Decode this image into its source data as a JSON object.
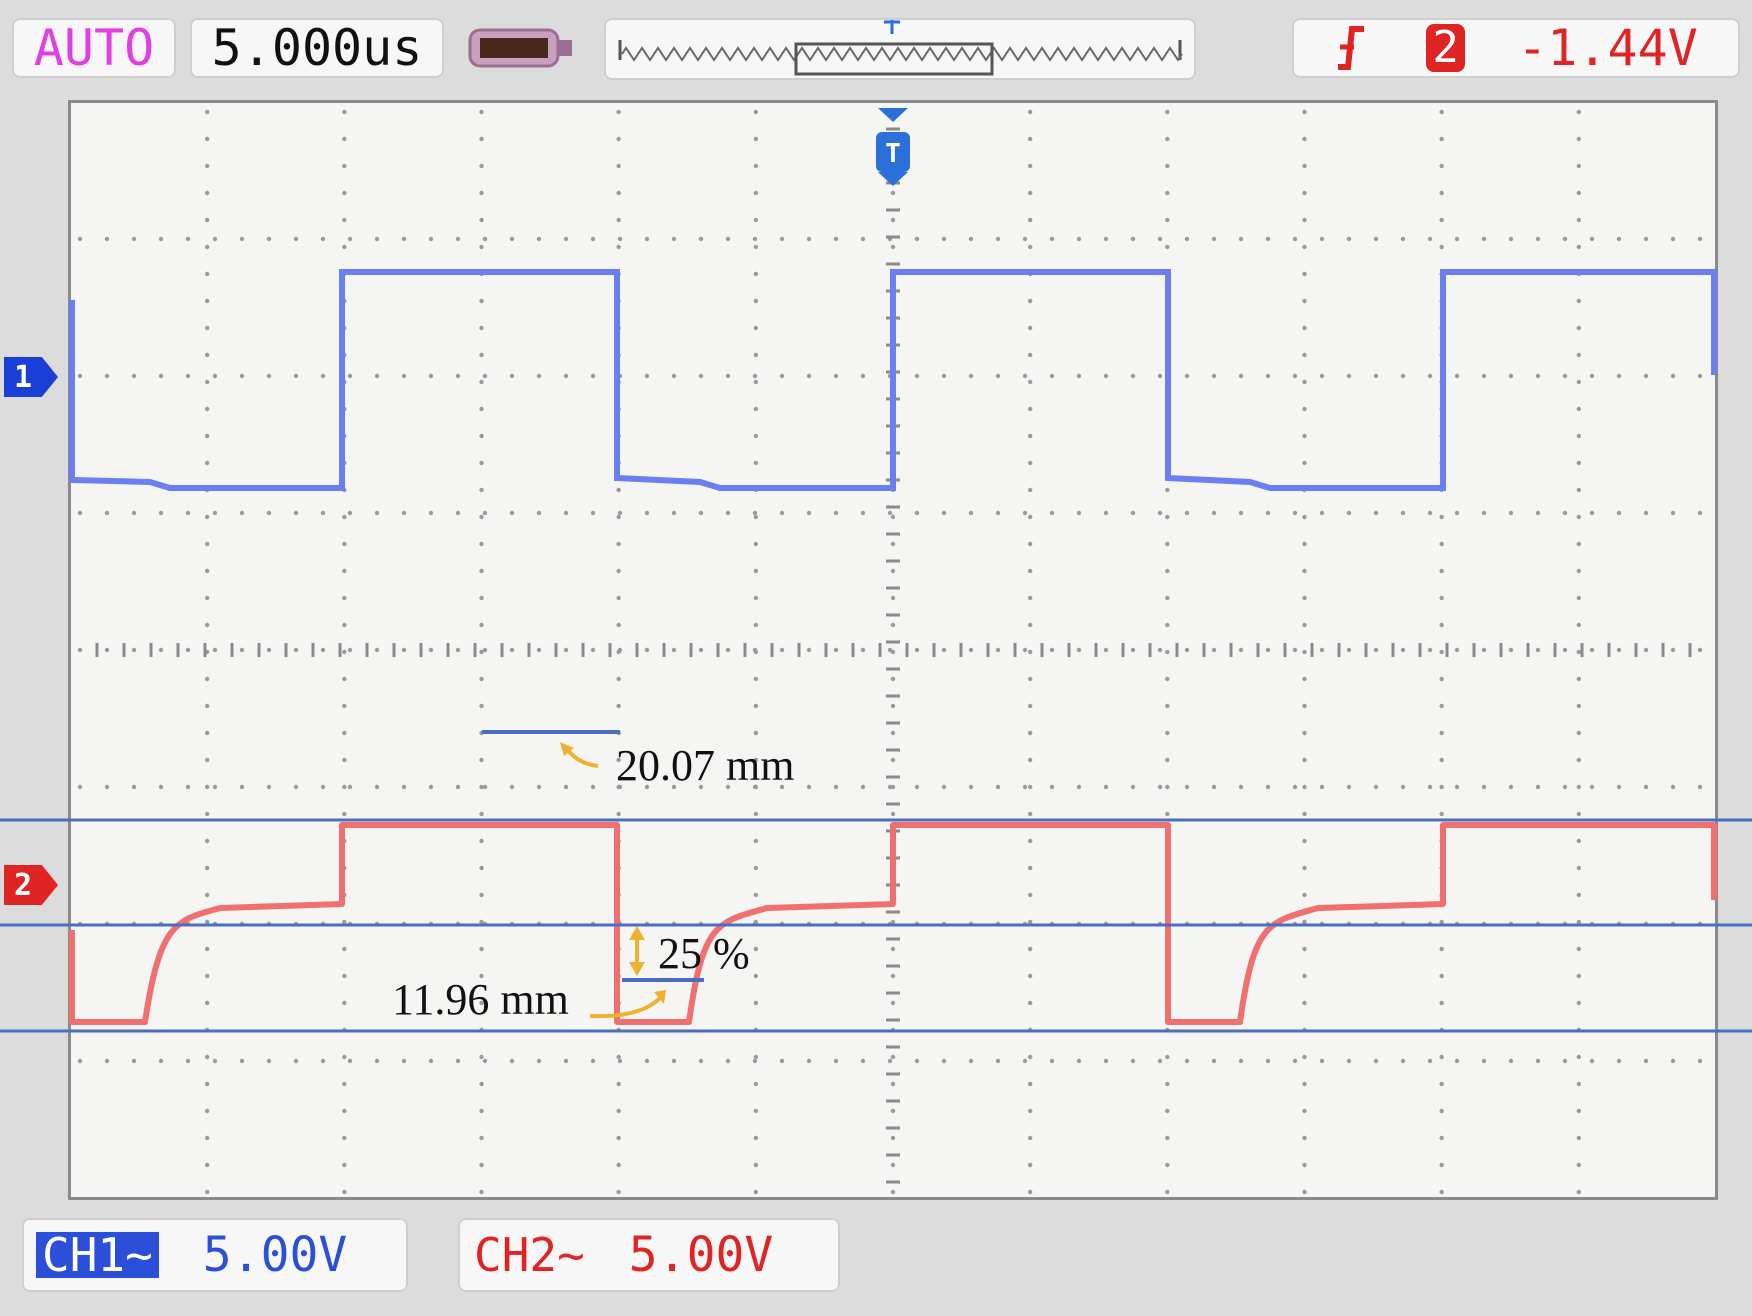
{
  "header": {
    "mode": "AUTO",
    "timebase": "5.000us",
    "trigger_source": "2",
    "trigger_level": "-1.44V"
  },
  "footer": {
    "ch1_label": "CH1~",
    "ch1_scale": "5.00V",
    "ch2_label": "CH2~",
    "ch2_scale": "5.00V"
  },
  "markers": {
    "ch1": "1",
    "ch2": "2",
    "trigger": "T"
  },
  "annotations": {
    "pulse_width": "20.07 mm",
    "fall_ratio": "25 %",
    "step_width": "11.96 mm"
  },
  "icons": {
    "trigger_edge": "falling-edge-icon",
    "battery": "battery-icon"
  },
  "colors": {
    "ch1": "#6b7ff0",
    "ch2": "#f07070",
    "annotation_line": "#4a6fc0",
    "annotation_arrow": "#f0b030",
    "mode_text": "#e040e0"
  }
}
